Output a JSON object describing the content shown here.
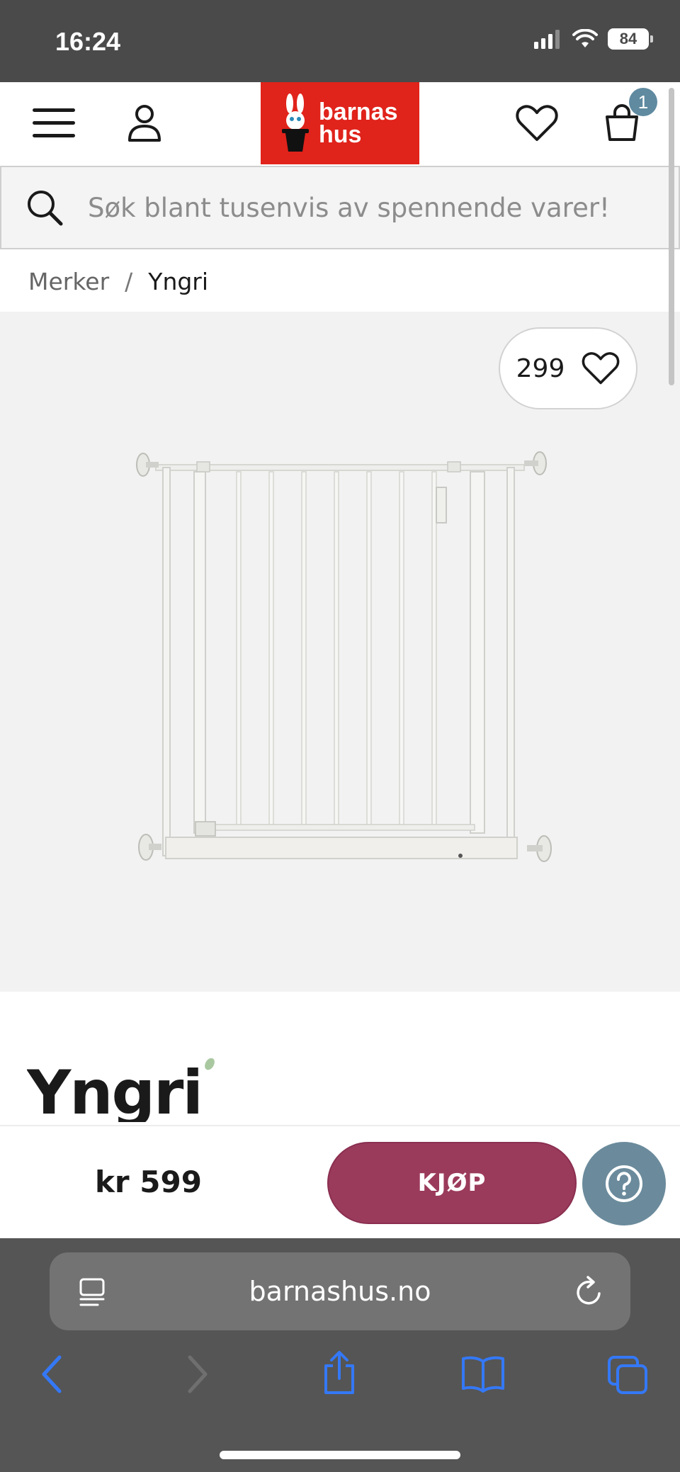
{
  "status_bar": {
    "time": "16:24",
    "battery": "84"
  },
  "header": {
    "logo_text_line1": "barnas",
    "logo_text_line2": "hus",
    "cart_count": "1",
    "icons": {
      "menu": "menu-icon",
      "account": "user-icon",
      "favorite": "heart-icon",
      "cart": "bag-icon"
    },
    "logo_color": "#e0231b"
  },
  "search": {
    "placeholder": "Søk blant tusenvis av spennende varer!"
  },
  "breadcrumb": {
    "items": [
      "Merker",
      "Yngri"
    ],
    "separator": "/"
  },
  "product": {
    "favorite_count": "299",
    "brand_logo_text": "Yngri",
    "price": "kr 599",
    "buy_label": "KJØP"
  },
  "browser": {
    "url": "barnashus.no"
  },
  "colors": {
    "buy_button": "#9b3b5c",
    "help_button": "#6b8b9c",
    "badge": "#5f8aa0",
    "safari_blue": "#3478f6"
  }
}
